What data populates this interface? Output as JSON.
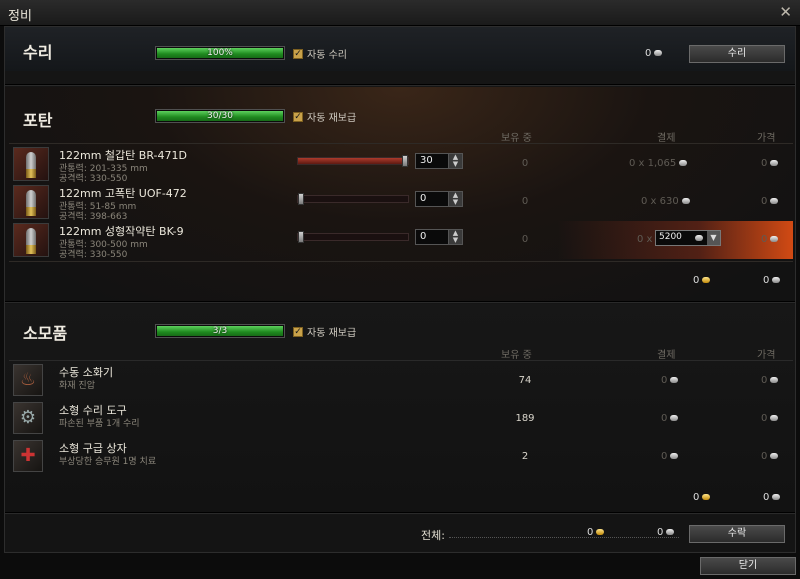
{
  "window": {
    "title": "정비",
    "close_glyph": "✕"
  },
  "repair": {
    "title": "수리",
    "progress_label": "100%",
    "progress": 1.0,
    "auto_label": "자동 수리",
    "cost": "0",
    "button": "수리"
  },
  "ammo": {
    "title": "포탄",
    "progress_label": "30/30",
    "progress": 1.0,
    "auto_label": "자동 재보급",
    "col_owned": "보유 중",
    "col_payment": "결제",
    "col_price": "가격",
    "items": [
      {
        "name": "122mm 철갑탄 BR-471D",
        "pen": "관통력: 201-335 mm",
        "dmg": "공격력: 330-550",
        "slider": 1.0,
        "count": "30",
        "owned": "0",
        "payment": "0 x 1,065",
        "price": "0"
      },
      {
        "name": "122mm 고폭탄 UOF-472",
        "pen": "관통력: 51-85 mm",
        "dmg": "공격력: 398-663",
        "slider": 0.0,
        "count": "0",
        "owned": "0",
        "payment": "0 x 630",
        "price": "0"
      },
      {
        "name": "122mm 성형작약탄 BK-9",
        "pen": "관통력: 300-500 mm",
        "dmg": "공격력: 330-550",
        "slider": 0.0,
        "count": "0",
        "owned": "0",
        "payment_prefix": "0 x",
        "payment_select": "5200",
        "price": "0"
      }
    ],
    "total_gold": "0",
    "total_silver": "0"
  },
  "consumables": {
    "title": "소모품",
    "progress_label": "3/3",
    "progress": 1.0,
    "auto_label": "자동 재보급",
    "col_owned": "보유 중",
    "col_payment": "결제",
    "col_price": "가격",
    "items": [
      {
        "name": "수동 소화기",
        "desc": "화재 진압",
        "owned": "74",
        "payment": "0",
        "price": "0",
        "icon": "fire-extinguisher-icon"
      },
      {
        "name": "소형 수리 도구",
        "desc": "파손된 부품 1개 수리",
        "owned": "189",
        "payment": "0",
        "price": "0",
        "icon": "repair-kit-icon"
      },
      {
        "name": "소형 구급 상자",
        "desc": "부상당한 승무원 1명 치료",
        "owned": "2",
        "payment": "0",
        "price": "0",
        "icon": "first-aid-icon"
      }
    ],
    "total_gold": "0",
    "total_silver": "0"
  },
  "footer": {
    "total_label": "전체:",
    "gold": "0",
    "silver": "0",
    "accept": "수락",
    "close": "닫기"
  },
  "colors": {
    "accent_green": "#2ea82e",
    "gold": "#e0b040",
    "highlight_red": "#c23a1c"
  }
}
